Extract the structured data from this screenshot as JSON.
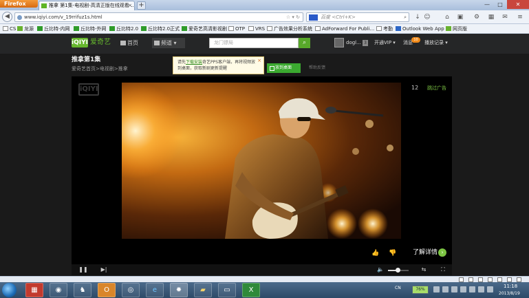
{
  "browser": {
    "menu_button": "Firefox",
    "tab_title": "推拿 第1集-电视剧-高清正版在线观看-...",
    "new_tab": "+",
    "window_controls": {
      "minimize": "—",
      "maximize": "□",
      "close": "✕"
    },
    "url": "www.iqiyi.com/v_19rrifuz1s.html",
    "search_placeholder": "百度 <Ctrl+K>",
    "bookmarks": [
      "CS",
      "龙源",
      "丘比特-内网",
      "丘比特-外网",
      "丘比特2.0",
      "丘比特2.0正式",
      "爱奇艺高清影视剧",
      "OTP",
      "VRS",
      "广告效果分析系统",
      "AdForward For Publi...",
      "考勤",
      "Outlook Web App",
      "网页版"
    ]
  },
  "site": {
    "logo_mark": "iQIYI",
    "logo_name": "爱奇艺",
    "nav": {
      "home": "首页",
      "channels": "频道"
    },
    "search_placeholder": "龙门镖局",
    "user": {
      "name": "dogl...",
      "tag": "3"
    },
    "vip": "开通VIP",
    "messages": {
      "label": "消息",
      "badge": "10"
    },
    "history": "播放记录"
  },
  "page": {
    "title": "推拿第1集",
    "breadcrumb": "爱奇艺首页>电视剧>推拿",
    "tooltip": {
      "prefix": "请先",
      "link": "下载安装",
      "text": "奇艺PPS客户端，再将视频放到桌面，获取新剧更新提醒",
      "close": "×"
    },
    "desktop_button": "放到桌面",
    "feedback": "帮助反馈"
  },
  "player": {
    "logo": "iQIYI",
    "ad_countdown": "12",
    "skip_ad": "跳过广告",
    "details_label": "了解详情",
    "details_icon": "chevron-right-icon",
    "volume": 0.45,
    "controls": {
      "play": "❚❚",
      "next": "▶|",
      "volume_icon": "🔈",
      "swap": "⇆",
      "fullscreen": "⛶"
    }
  },
  "taskbar": {
    "apps": [
      "gift-icon",
      "qq-icon",
      "penguin-icon",
      "outlook-icon",
      "chrome-icon",
      "ie-icon",
      "firefox-icon",
      "folder-icon",
      "window-icon",
      "excel-icon"
    ],
    "language": "CN",
    "battery": "76%",
    "time": "11:18",
    "date": "2013/8/19"
  },
  "colors": {
    "brand_green": "#66b72e",
    "dark_bg": "#1a1a1a",
    "header_bg": "#252627"
  }
}
